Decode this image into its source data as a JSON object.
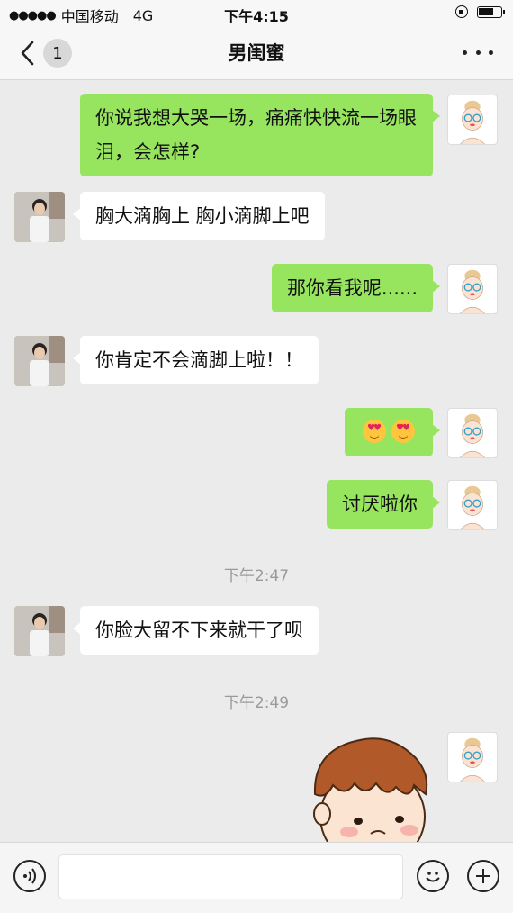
{
  "status_bar": {
    "carrier": "中国移动",
    "network": "4G",
    "time": "下午4:15"
  },
  "nav": {
    "back_badge": "1",
    "title": "男闺蜜"
  },
  "messages": [
    {
      "side": "sent",
      "text": "你说我想大哭一场，痛痛快快流一场眼泪，会怎样?"
    },
    {
      "side": "recv",
      "text": "胸大滴胸上 胸小滴脚上吧"
    },
    {
      "side": "sent",
      "text": "那你看我呢......"
    },
    {
      "side": "recv",
      "text": "你肯定不会滴脚上啦！！"
    },
    {
      "side": "sent",
      "type": "emoji",
      "icon": "heart-eyes-emoji",
      "count": 2
    },
    {
      "side": "sent",
      "text": "讨厌啦你"
    },
    {
      "type": "time",
      "text": "下午2:47"
    },
    {
      "side": "recv",
      "text": "你脸大留不下来就干了呗"
    },
    {
      "type": "time",
      "text": "下午2:49"
    },
    {
      "side": "sent",
      "type": "sticker",
      "icon": "cartoon-boy-sticker"
    }
  ],
  "input_bar": {
    "value": "",
    "placeholder": ""
  },
  "colors": {
    "sent_bubble": "#97e55f",
    "recv_bubble": "#ffffff",
    "background": "#ebebeb"
  }
}
